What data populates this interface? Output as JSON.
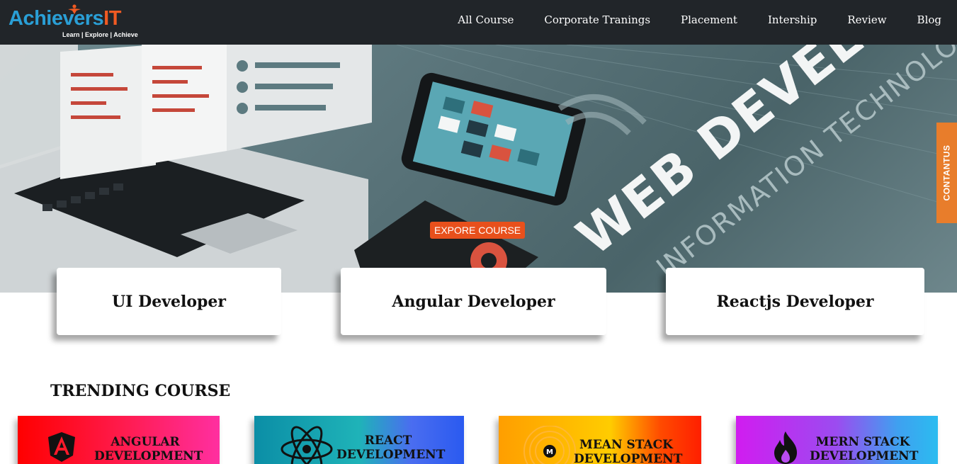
{
  "header": {
    "logo_main": "Achievers",
    "logo_it": "IT",
    "logo_tagline": "Learn | Explore | Achieve",
    "nav": [
      "All Course",
      "Corporate Tranings",
      "Placement",
      "Intership",
      "Review",
      "Blog"
    ]
  },
  "hero": {
    "explore_button": "EXPORE COURSE",
    "image_text_main": "WEB DEVELOPMENT",
    "image_text_sub": "INFORMATION TECHNOLOGY"
  },
  "contact_tab": "CONTANTUS",
  "course_cards": [
    "UI Developer",
    "Angular Developer",
    "Reactjs Developer"
  ],
  "trending": {
    "heading": "TRENDING COURSE",
    "cards": [
      {
        "line1": "ANGULAR",
        "line2": "DEVELOPMENT",
        "icon": "angular-icon"
      },
      {
        "line1": "REACT",
        "line2": "DEVELOPMENT",
        "icon": "react-icon"
      },
      {
        "line1": "MEAN STACK",
        "line2": "DEVELOPMENT",
        "icon": "mean-stack-icon"
      },
      {
        "line1": "MERN STACK",
        "line2": "DEVELOPMENT",
        "icon": "mern-stack-icon"
      }
    ]
  },
  "colors": {
    "navbar": "#212529",
    "accent_orange": "#e8501c",
    "contact_tab": "#e87d2b",
    "logo_blue": "#2a9fd6"
  }
}
